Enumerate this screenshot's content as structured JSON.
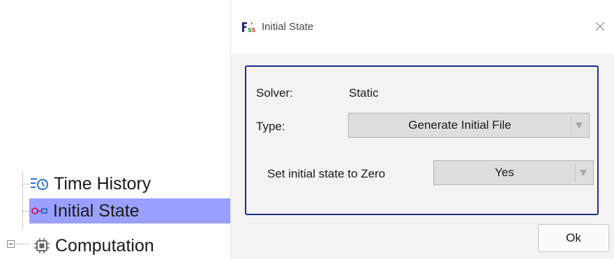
{
  "tree": {
    "items": [
      {
        "label": "Time History",
        "icon": "time-history-icon"
      },
      {
        "label": "Initial State",
        "icon": "initial-state-icon",
        "selected": true
      },
      {
        "label": "Computation",
        "icon": "chip-icon",
        "expandable": true,
        "expanded": true
      }
    ],
    "selection_color": "#9aa0ff"
  },
  "dialog": {
    "title": "Initial State",
    "close_symbol": "×",
    "panel_border_color": "#1f2a8f",
    "solver": {
      "label": "Solver:",
      "value": "Static"
    },
    "type": {
      "label": "Type:",
      "value": "Generate Initial File"
    },
    "zero": {
      "label": "Set initial state to Zero",
      "value": "Yes"
    },
    "ok_label": "Ok"
  }
}
